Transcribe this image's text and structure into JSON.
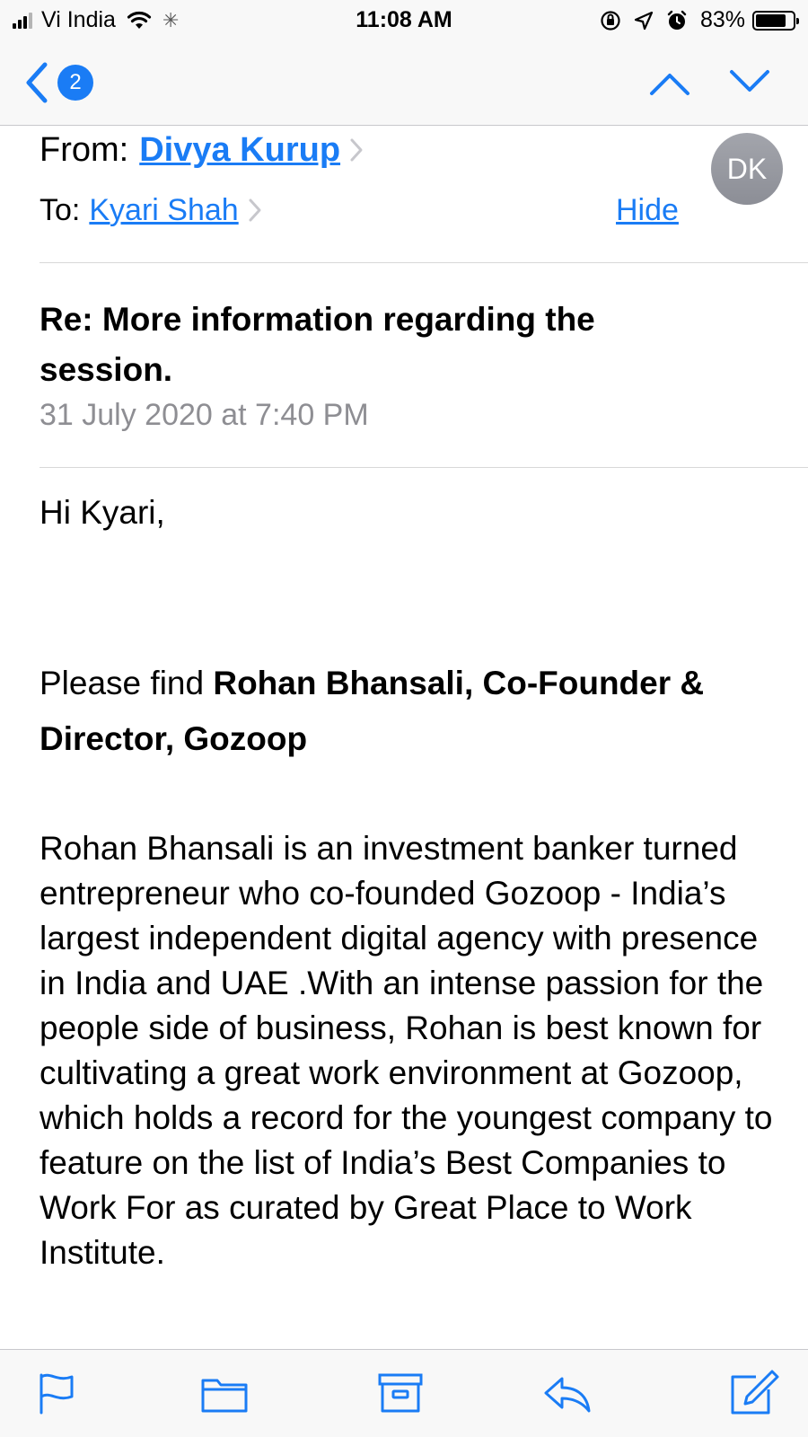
{
  "status_bar": {
    "carrier": "Vi India",
    "time": "11:08 AM",
    "battery_percent": "83%",
    "battery_level": 0.83,
    "icons": [
      "signal-icon",
      "wifi-icon",
      "activity-spinner-icon",
      "orientation-lock-icon",
      "location-icon",
      "alarm-icon",
      "battery-icon"
    ]
  },
  "nav": {
    "unread_count": "2",
    "icons": [
      "back-chevron-icon",
      "up-arrow-icon",
      "down-arrow-icon"
    ]
  },
  "accent_color": "#1a7cf5",
  "email": {
    "from_label": "From:",
    "from_name": "Divya Kurup",
    "to_label": "To:",
    "to_name": "Kyari Shah",
    "hide_label": "Hide",
    "avatar_initials": "DK",
    "subject": "Re: More information regarding the session.",
    "date": "31 July 2020 at 7:40 PM",
    "greeting": "Hi Kyari,",
    "intro_prefix": "Please find ",
    "intro_bold": "Rohan Bhansali, Co-Founder & Director, Gozoop",
    "bio": "Rohan Bhansali is an investment banker turned entrepreneur who co-founded Gozoop - India’s largest independent digital agency with presence in India and  UAE .With an intense passion for the people side of business, Rohan is best known for cultivating a great work environment at Gozoop, which holds a record for the youngest company to feature on the list of India’s Best Companies to Work For as curated by Great Place to Work Institute."
  },
  "toolbar": {
    "icons": [
      "flag-icon",
      "folder-icon",
      "archive-icon",
      "reply-icon",
      "compose-icon"
    ]
  }
}
